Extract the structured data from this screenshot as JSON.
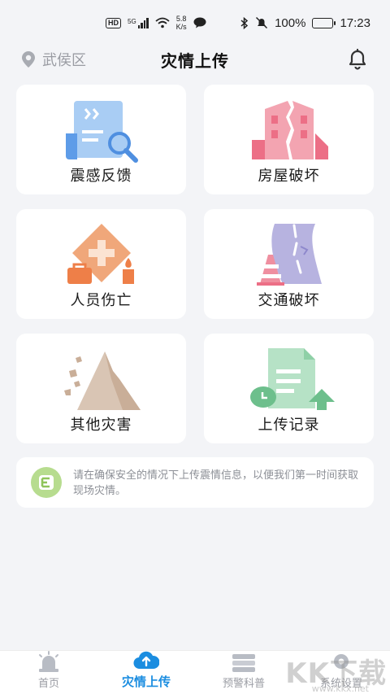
{
  "status_bar": {
    "hd": "HD",
    "signal_type": "5G",
    "net_speed_value": "5.8",
    "net_speed_unit": "K/s",
    "battery": "100%",
    "time": "17:23"
  },
  "header": {
    "location": "武侯区",
    "title": "灾情上传"
  },
  "cards": [
    {
      "label": "震感反馈",
      "icon": "felt-report-icon"
    },
    {
      "label": "房屋破坏",
      "icon": "house-damage-icon"
    },
    {
      "label": "人员伤亡",
      "icon": "casualty-icon"
    },
    {
      "label": "交通破坏",
      "icon": "traffic-damage-icon"
    },
    {
      "label": "其他灾害",
      "icon": "landslide-icon"
    },
    {
      "label": "上传记录",
      "icon": "upload-record-icon"
    }
  ],
  "notice": {
    "text": "请在确保安全的情况下上传震情信息，以便我们第一时间获取现场灾情。"
  },
  "tabs": [
    {
      "label": "首页",
      "icon": "alarm-icon",
      "active": false
    },
    {
      "label": "灾情上传",
      "icon": "cloud-upload-icon",
      "active": true
    },
    {
      "label": "预警科普",
      "icon": "book-icon",
      "active": false
    },
    {
      "label": "系统设置",
      "icon": "settings-icon",
      "active": false
    }
  ],
  "watermark": {
    "text": "KK下载",
    "sub": "www.kkx.net"
  },
  "colors": {
    "accent": "#1b8de0",
    "background": "#f3f4f7",
    "card": "#ffffff"
  }
}
